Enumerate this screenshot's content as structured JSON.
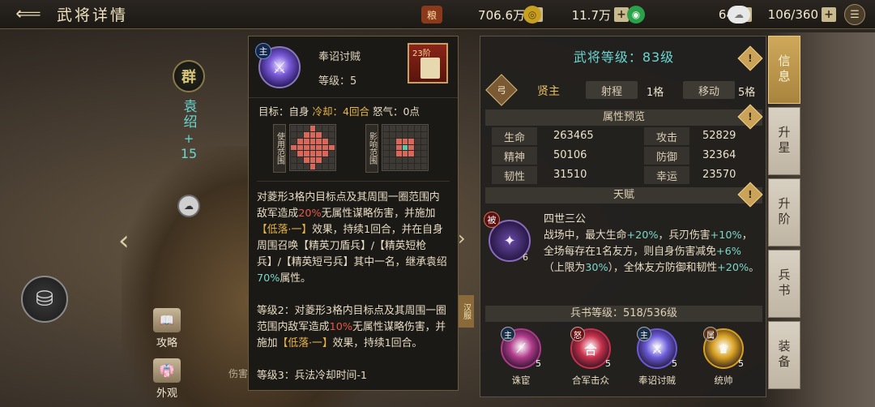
{
  "header": {
    "back_icon": "back-arrow-icon",
    "title": "武将详情",
    "resources": [
      {
        "name": "supply",
        "icon": "grain-icon",
        "value": "706.6万"
      },
      {
        "name": "gold",
        "icon": "coin-icon",
        "value": "11.7万"
      },
      {
        "name": "jade",
        "icon": "jade-icon",
        "value": "64"
      },
      {
        "name": "troops",
        "icon": "cloud-icon",
        "value": "106/360"
      }
    ],
    "plus_label": "+",
    "menu_icon": "menu-icon"
  },
  "hero": {
    "faction": "群",
    "name": "袁绍",
    "plus": "+",
    "level": "15",
    "side_buttons": [
      {
        "label": "攻略",
        "icon": "book-icon"
      },
      {
        "label": "外观",
        "icon": "costume-icon"
      }
    ],
    "bottom_hint": "伤害",
    "skin_tag": "汉服"
  },
  "tooltip": {
    "skill_tag": "主",
    "skill_name": "奉诏讨贼",
    "level_text": "等级：5",
    "book_stage": "23阶",
    "meta_prefix": "目标：自身",
    "meta_cd": "冷却：4回合",
    "meta_rage": "怒气：0点",
    "grid_use_label": "使用范围",
    "grid_affect_label": "影响范围",
    "desc1": {
      "a": "对菱形3格内目标点及其周围一圈范围内敌军造成",
      "pct": "20%",
      "b": "无属性谋略伤害，并施加",
      "tag": "【低落·一】",
      "c": "效果，持续1回合，并在自身周围召唤【精英刀盾兵】/【精英短枪兵】/【精英短弓兵】其中一名，继承袁绍",
      "pct2": "70%",
      "d": "属性。"
    },
    "desc2": {
      "a": "等级2：对菱形3格内目标点及其周围一圈范围内敌军造成",
      "pct": "10%",
      "b": "无属性谋略伤害，并施加",
      "tag": "【低落·一】",
      "c": "效果，持续1回合。"
    },
    "desc3": "等级3：兵法冷却时间-1"
  },
  "panel": {
    "title": "武将等级：83级",
    "class_icon": "archer-class-icon",
    "class_icon_glyph": "弓",
    "class_name": "贤主",
    "range_label": "射程",
    "range_value": "1格",
    "move_label": "移动",
    "move_value": "5格",
    "attr_section": "属性预览",
    "attributes": [
      {
        "label": "生命",
        "value": "263465"
      },
      {
        "label": "攻击",
        "value": "52829"
      },
      {
        "label": "精神",
        "value": "50106"
      },
      {
        "label": "防御",
        "value": "32364"
      },
      {
        "label": "韧性",
        "value": "31510"
      },
      {
        "label": "幸运",
        "value": "23570"
      }
    ],
    "talent_section": "天赋",
    "talent": {
      "badge": "被",
      "level": "6",
      "name": "四世三公",
      "t1": "战场中，最大生命",
      "v1": "+20%",
      "t2": "，兵刃伤害",
      "v2": "+10%",
      "t3": "，全场每存在1名友方，则自身伤害减免",
      "v3": "+6%",
      "t4": "（上限为",
      "v4": "30%",
      "t5": "），全体友方防御和韧性",
      "v5": "+20%",
      "t6": "。"
    },
    "book_section": "兵书等级：518/536级",
    "books": [
      {
        "tag": "主",
        "name": "诛宦",
        "level": "5",
        "icon": "slash-icon",
        "color": "#b03a8a",
        "tagcolor": "#18304a"
      },
      {
        "tag": "怒",
        "name": "合军击众",
        "level": "5",
        "icon": "unite-icon",
        "color": "#c8304a",
        "tagcolor": "#6a1010"
      },
      {
        "tag": "主",
        "name": "奉诏讨贼",
        "level": "5",
        "icon": "sword-icon",
        "color": "#6a5ad8",
        "tagcolor": "#18304a"
      },
      {
        "tag": "属",
        "name": "统帅",
        "level": "5",
        "icon": "helmet-icon",
        "color": "#d8a020",
        "tagcolor": "#5a3010"
      }
    ],
    "warn_symbol": "!"
  },
  "tabs": [
    {
      "label": "信息",
      "active": true
    },
    {
      "label": "升星",
      "active": false
    },
    {
      "label": "升阶",
      "active": false
    },
    {
      "label": "兵书",
      "active": false
    },
    {
      "label": "装备",
      "active": false
    }
  ],
  "colors": {
    "teal": "#6ad6d0",
    "gold": "#e8b648",
    "red": "#e65a48",
    "active_tab": "#cfa85a"
  }
}
